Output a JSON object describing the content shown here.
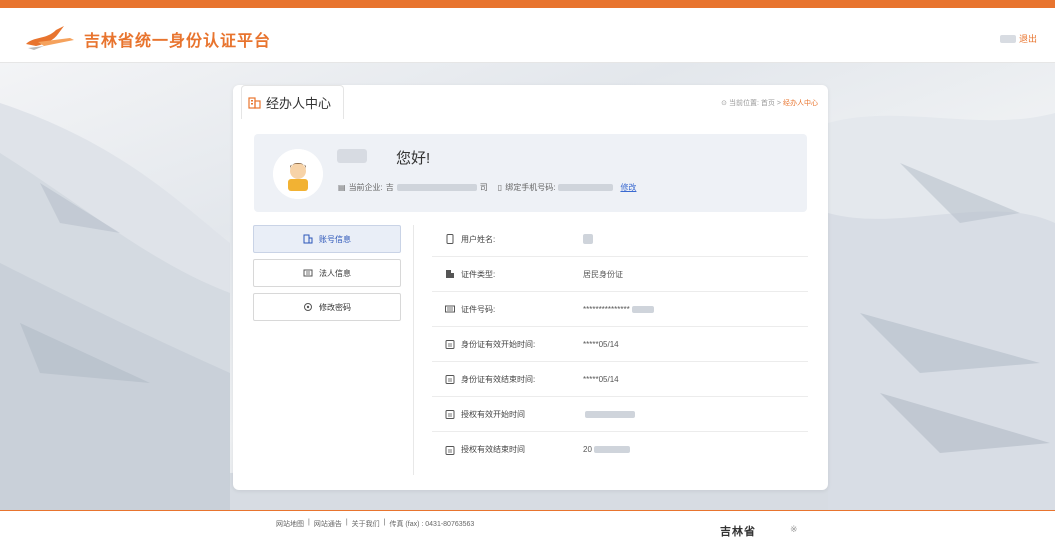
{
  "header": {
    "site_title": "吉林省统一身份认证平台",
    "logout_label": "退出"
  },
  "panel": {
    "title": "经办人中心",
    "breadcrumb": {
      "prefix": "当前位置:",
      "home": "首页",
      "separator": ">",
      "current": "经办人中心"
    }
  },
  "user_card": {
    "greeting": "您好!",
    "company_label": "当前企业:",
    "company_prefix": "吉",
    "company_suffix": "司",
    "phone_label": "绑定手机号码:",
    "edit_link": "修改"
  },
  "side_menu": {
    "items": [
      {
        "label": "账号信息",
        "icon": "account-icon",
        "active": true
      },
      {
        "label": "法人信息",
        "icon": "legal-person-icon",
        "active": false
      },
      {
        "label": "修改密码",
        "icon": "password-icon",
        "active": false
      }
    ]
  },
  "info": {
    "rows": [
      {
        "label": "用户姓名:",
        "value": "",
        "icon": "phone-icon"
      },
      {
        "label": "证件类型:",
        "value": "居民身份证",
        "icon": "building-icon"
      },
      {
        "label": "证件号码:",
        "value": "***************",
        "icon": "id-card-icon"
      },
      {
        "label": "身份证有效开始时间:",
        "value": "*****05/14",
        "icon": "calendar-icon"
      },
      {
        "label": "身份证有效结束时间:",
        "value": "*****05/14",
        "icon": "calendar-icon"
      },
      {
        "label": "授权有效开始时间",
        "value": "",
        "icon": "calendar-icon"
      },
      {
        "label": "授权有效结束时间",
        "value": "20",
        "icon": "calendar-icon"
      }
    ]
  },
  "footer": {
    "links": [
      "网站地图",
      "|",
      "网站通告",
      "|",
      "关于我们",
      "|",
      "传真 (fax) : 0431-80763563"
    ],
    "logo_text": "吉林省"
  },
  "colors": {
    "accent": "#e8742e",
    "link": "#3a6ad1",
    "active_menu_bg": "#e9eef7"
  }
}
